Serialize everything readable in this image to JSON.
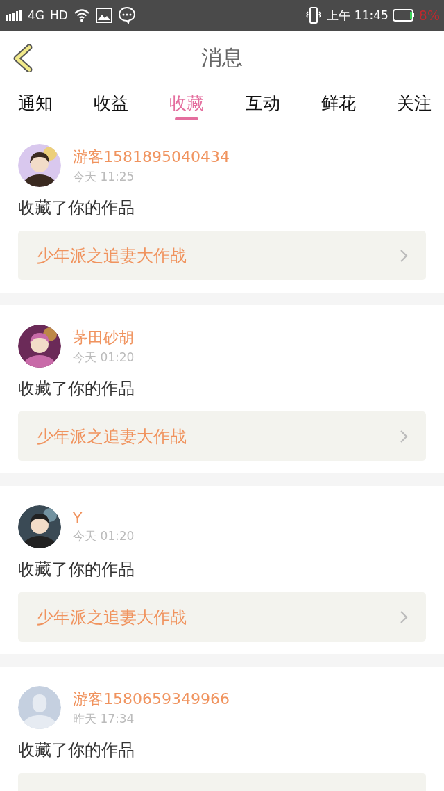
{
  "status_bar": {
    "network": "4G",
    "hd": "HD",
    "time": "上午 11:45",
    "battery": "8%"
  },
  "header": {
    "title": "消息"
  },
  "tabs": [
    {
      "label": "通知",
      "selected": false
    },
    {
      "label": "收益",
      "selected": false
    },
    {
      "label": "收藏",
      "selected": true
    },
    {
      "label": "互动",
      "selected": false
    },
    {
      "label": "鲜花",
      "selected": false
    },
    {
      "label": "关注",
      "selected": false
    }
  ],
  "messages": [
    {
      "name": "游客1581895040434",
      "time": "今天 11:25",
      "action": "收藏了你的作品",
      "work": "少年派之追妻大作战"
    },
    {
      "name": "茅田砂胡",
      "time": "今天 01:20",
      "action": "收藏了你的作品",
      "work": "少年派之追妻大作战"
    },
    {
      "name": "Y",
      "time": "今天 01:20",
      "action": "收藏了你的作品",
      "work": "少年派之追妻大作战"
    },
    {
      "avatar": {
        "kind": "default"
      },
      "name": "游客1580659349966",
      "time": "昨天 17:34",
      "action": "收藏了你的作品"
    }
  ]
}
